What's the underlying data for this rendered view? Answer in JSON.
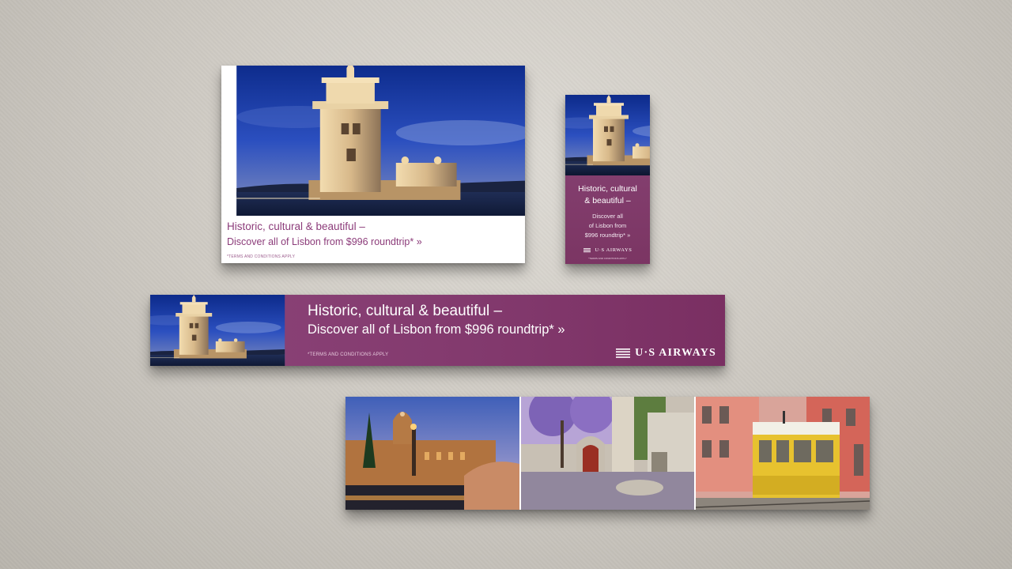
{
  "headline": {
    "line1": "Historic, cultural & beautiful –",
    "line2": "Discover all of Lisbon from $996 roundtrip* »"
  },
  "skyscraper": {
    "line1a": "Historic, cultural",
    "line1b": "& beautiful –",
    "line2a": "Discover all",
    "line2b": "of Lisbon from",
    "line2c": "$996 roundtrip* »"
  },
  "terms": "*TERMS AND CONDITIONS APPLY",
  "brand": {
    "name": "U·S AIRWAYS",
    "color": "#82396d"
  },
  "photos": {
    "tower": "belem-tower-photo",
    "monastery": "jeronimos-monastery-photo",
    "courtyard": "jacaranda-courtyard-photo",
    "tram": "yellow-tram-photo"
  }
}
